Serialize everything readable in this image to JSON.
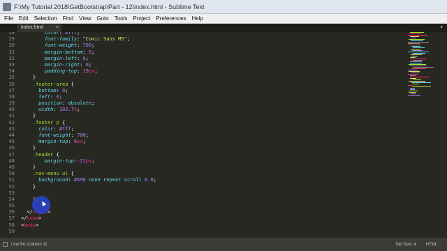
{
  "window": {
    "title": "F:\\My Tutorial 2018\\GetBootstrap\\Part - 12\\index.html - Sublime Text"
  },
  "menu": [
    "File",
    "Edit",
    "Selection",
    "Find",
    "View",
    "Goto",
    "Tools",
    "Project",
    "Preferences",
    "Help"
  ],
  "tab": {
    "label": "index.html",
    "close_glyph": "×",
    "dropdown_glyph": "▾"
  },
  "editor": {
    "lines": [
      {
        "n": "28",
        "tokens": [
          [
            "        ",
            "punc"
          ],
          [
            "color",
            "prop"
          ],
          [
            ": ",
            "punc"
          ],
          [
            "#fff",
            "num"
          ],
          [
            ";",
            "punc"
          ]
        ]
      },
      {
        "n": "29",
        "tokens": [
          [
            "        ",
            "punc"
          ],
          [
            "font-family",
            "prop"
          ],
          [
            ": ",
            "punc"
          ],
          [
            "\"Comic Sans MS\"",
            "str"
          ],
          [
            ";",
            "punc"
          ]
        ]
      },
      {
        "n": "30",
        "tokens": [
          [
            "        ",
            "punc"
          ],
          [
            "font-weight",
            "prop"
          ],
          [
            ": ",
            "punc"
          ],
          [
            "700",
            "num"
          ],
          [
            ";",
            "punc"
          ]
        ]
      },
      {
        "n": "31",
        "tokens": [
          [
            "        ",
            "punc"
          ],
          [
            "margin-bottom",
            "prop"
          ],
          [
            ": ",
            "punc"
          ],
          [
            "0",
            "num"
          ],
          [
            ";",
            "punc"
          ]
        ]
      },
      {
        "n": "32",
        "tokens": [
          [
            "        ",
            "punc"
          ],
          [
            "margin-left",
            "prop"
          ],
          [
            ": ",
            "punc"
          ],
          [
            "0",
            "num"
          ],
          [
            ";",
            "punc"
          ]
        ]
      },
      {
        "n": "33",
        "tokens": [
          [
            "        ",
            "punc"
          ],
          [
            "margin-right",
            "prop"
          ],
          [
            ": ",
            "punc"
          ],
          [
            "0",
            "num"
          ],
          [
            ";",
            "punc"
          ]
        ]
      },
      {
        "n": "34",
        "tokens": [
          [
            "        ",
            "punc"
          ],
          [
            "padding-top",
            "prop"
          ],
          [
            ": ",
            "punc"
          ],
          [
            "19",
            "num"
          ],
          [
            "px",
            "unit"
          ],
          [
            ";",
            "punc"
          ]
        ]
      },
      {
        "n": "35",
        "tokens": [
          [
            "    }",
            "punc"
          ]
        ]
      },
      {
        "n": "36",
        "tokens": [
          [
            "    ",
            "punc"
          ],
          [
            ".footer-area",
            "sel"
          ],
          [
            " {",
            "punc"
          ]
        ]
      },
      {
        "n": "37",
        "tokens": [
          [
            "      ",
            "punc"
          ],
          [
            "bottom",
            "prop"
          ],
          [
            ": ",
            "punc"
          ],
          [
            "0",
            "num"
          ],
          [
            ";",
            "punc"
          ]
        ]
      },
      {
        "n": "38",
        "tokens": [
          [
            "      ",
            "punc"
          ],
          [
            "left",
            "prop"
          ],
          [
            ": ",
            "punc"
          ],
          [
            "0",
            "num"
          ],
          [
            ";",
            "punc"
          ]
        ]
      },
      {
        "n": "39",
        "tokens": [
          [
            "      ",
            "punc"
          ],
          [
            "position",
            "prop"
          ],
          [
            ": ",
            "punc"
          ],
          [
            "absolute",
            "kw"
          ],
          [
            ";",
            "punc"
          ]
        ]
      },
      {
        "n": "40",
        "tokens": [
          [
            "      ",
            "punc"
          ],
          [
            "width",
            "prop"
          ],
          [
            ": ",
            "punc"
          ],
          [
            "102.7",
            "num"
          ],
          [
            "%",
            "unit"
          ],
          [
            ";",
            "punc"
          ]
        ]
      },
      {
        "n": "41",
        "tokens": [
          [
            "    }",
            "punc"
          ]
        ]
      },
      {
        "n": "42",
        "tokens": [
          [
            "    ",
            "punc"
          ],
          [
            ".footer p",
            "sel"
          ],
          [
            " {",
            "punc"
          ]
        ]
      },
      {
        "n": "43",
        "tokens": [
          [
            "      ",
            "punc"
          ],
          [
            "color",
            "prop"
          ],
          [
            ": ",
            "punc"
          ],
          [
            "#fff",
            "num"
          ],
          [
            ";",
            "punc"
          ]
        ]
      },
      {
        "n": "44",
        "tokens": [
          [
            "      ",
            "punc"
          ],
          [
            "font-weight",
            "prop"
          ],
          [
            ": ",
            "punc"
          ],
          [
            "700",
            "num"
          ],
          [
            ";",
            "punc"
          ]
        ]
      },
      {
        "n": "45",
        "tokens": [
          [
            "      ",
            "punc"
          ],
          [
            "margin-top",
            "prop"
          ],
          [
            ": ",
            "punc"
          ],
          [
            "6",
            "num"
          ],
          [
            "px",
            "unit"
          ],
          [
            ";",
            "punc"
          ]
        ]
      },
      {
        "n": "46",
        "tokens": [
          [
            "    }",
            "punc"
          ]
        ]
      },
      {
        "n": "47",
        "tokens": [
          [
            "    ",
            "punc"
          ],
          [
            ".header",
            "sel"
          ],
          [
            " {",
            "punc"
          ]
        ]
      },
      {
        "n": "48",
        "tokens": [
          [
            "        ",
            "punc"
          ],
          [
            "margin-top",
            "prop"
          ],
          [
            ":",
            "punc"
          ],
          [
            "-21",
            "num"
          ],
          [
            "px",
            "unit"
          ],
          [
            ";",
            "punc"
          ]
        ]
      },
      {
        "n": "49",
        "tokens": [
          [
            "    }",
            "punc"
          ]
        ]
      },
      {
        "n": "50",
        "tokens": [
          [
            "    ",
            "punc"
          ],
          [
            ".nav-menu ul",
            "sel"
          ],
          [
            " {",
            "punc"
          ]
        ]
      },
      {
        "n": "51",
        "tokens": [
          [
            "      ",
            "punc"
          ],
          [
            "background",
            "prop"
          ],
          [
            ": ",
            "punc"
          ],
          [
            "#696",
            "num"
          ],
          [
            " none repeat scroll ",
            "kw"
          ],
          [
            "0 0",
            "num"
          ],
          [
            ";",
            "punc"
          ]
        ]
      },
      {
        "n": "52",
        "tokens": [
          [
            "    }",
            "punc"
          ]
        ]
      },
      {
        "n": "53",
        "tokens": [
          [
            "",
            "punc"
          ]
        ]
      },
      {
        "n": "54",
        "tokens": [
          [
            "    ",
            "punc"
          ],
          [
            "|",
            "punc"
          ]
        ]
      },
      {
        "n": "55",
        "tokens": [
          [
            "",
            "punc"
          ]
        ]
      },
      {
        "n": "56",
        "tokens": [
          [
            "  ",
            "punc"
          ],
          [
            "</",
            "punc"
          ],
          [
            "style",
            "tag"
          ],
          [
            ">",
            "punc"
          ]
        ]
      },
      {
        "n": "57",
        "tokens": [
          [
            "",
            "punc"
          ],
          [
            "</",
            "punc"
          ],
          [
            "head",
            "tag"
          ],
          [
            ">",
            "punc"
          ]
        ]
      },
      {
        "n": "58",
        "tokens": [
          [
            "",
            "punc"
          ],
          [
            "<",
            "punc"
          ],
          [
            "body",
            "tag"
          ],
          [
            ">",
            "punc"
          ]
        ]
      },
      {
        "n": "59",
        "tokens": [
          [
            "",
            "punc"
          ]
        ]
      }
    ]
  },
  "status": {
    "position": "Line 54, Column 11",
    "tab_size": "Tab Size: 4",
    "syntax": "HTML"
  },
  "colors": {
    "editor_bg": "#272822",
    "selector": "#a6e22e",
    "property": "#66d9ef",
    "number": "#ae81ff",
    "unit": "#f92672",
    "string": "#e6db74",
    "cursor_highlight": "#2b42c8"
  }
}
